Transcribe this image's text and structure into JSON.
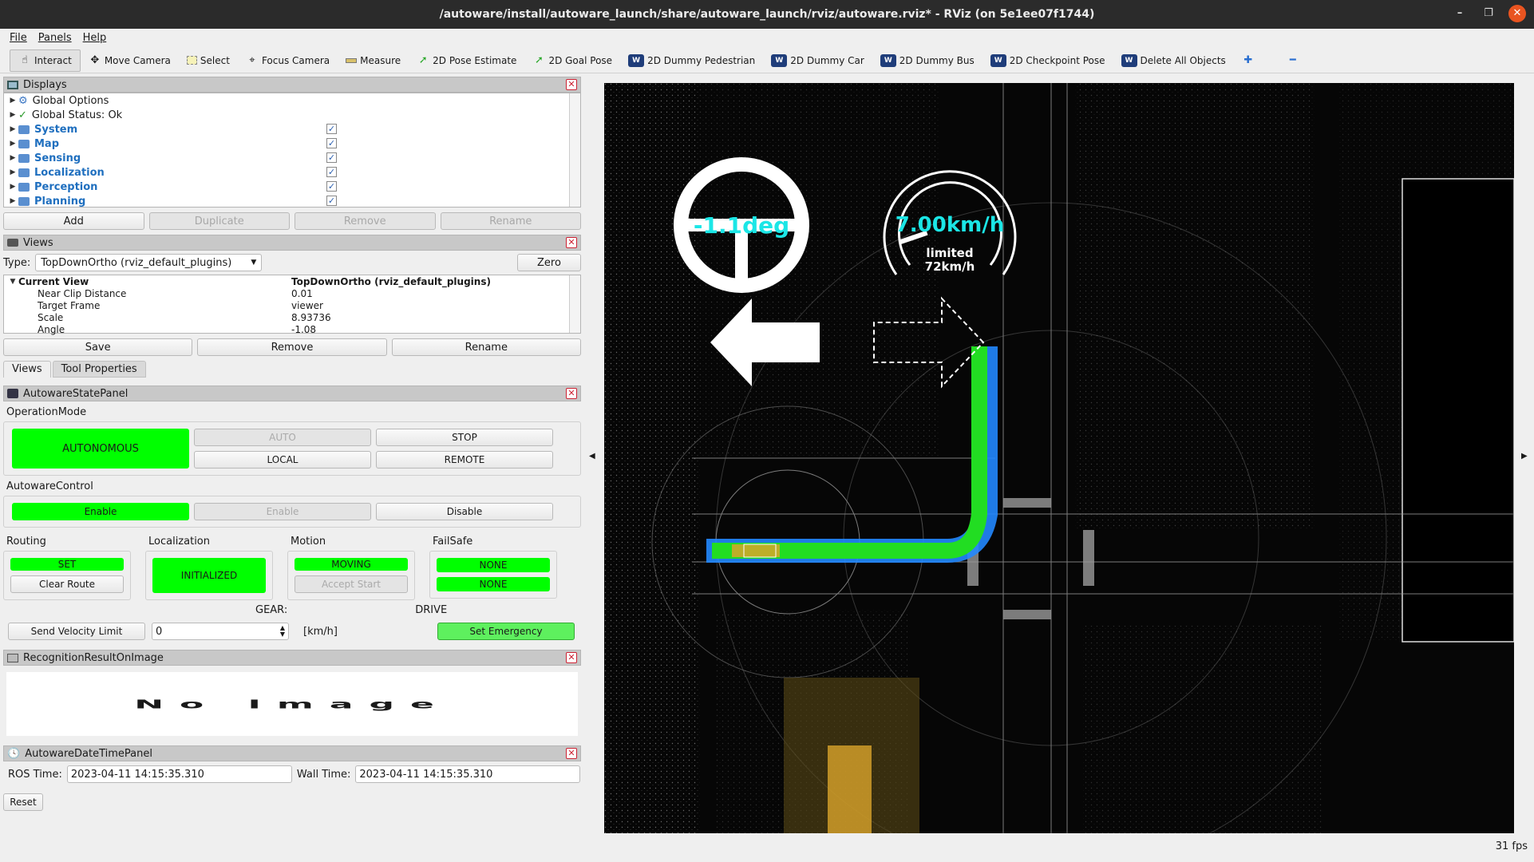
{
  "window": {
    "title": "/autoware/install/autoware_launch/share/autoware_launch/rviz/autoware.rviz* - RViz (on 5e1ee07f1744)"
  },
  "menu": {
    "items": [
      "File",
      "Panels",
      "Help"
    ]
  },
  "toolbar": {
    "interact": "Interact",
    "move_camera": "Move Camera",
    "select": "Select",
    "focus_camera": "Focus Camera",
    "measure": "Measure",
    "pose_estimate": "2D Pose Estimate",
    "goal_pose": "2D Goal Pose",
    "dummy_pedestrian": "2D Dummy Pedestrian",
    "dummy_car": "2D Dummy Car",
    "dummy_bus": "2D Dummy Bus",
    "checkpoint_pose": "2D Checkpoint Pose",
    "delete_all": "Delete All Objects"
  },
  "displays": {
    "title": "Displays",
    "items": [
      {
        "label": "Global Options"
      },
      {
        "label": "Global Status: Ok"
      },
      {
        "label": "System"
      },
      {
        "label": "Map"
      },
      {
        "label": "Sensing"
      },
      {
        "label": "Localization"
      },
      {
        "label": "Perception"
      },
      {
        "label": "Planning"
      }
    ],
    "buttons": {
      "add": "Add",
      "duplicate": "Duplicate",
      "remove": "Remove",
      "rename": "Rename"
    }
  },
  "views": {
    "title": "Views",
    "type_label": "Type:",
    "type_value": "TopDownOrtho (rviz_default_plugins)",
    "zero": "Zero",
    "current_view_label": "Current View",
    "current_view_value": "TopDownOrtho (rviz_default_plugins)",
    "props": [
      {
        "k": "Near Clip Distance",
        "v": "0.01"
      },
      {
        "k": "Target Frame",
        "v": "viewer"
      },
      {
        "k": "Scale",
        "v": "8.93736"
      },
      {
        "k": "Angle",
        "v": "-1.08"
      }
    ],
    "buttons": {
      "save": "Save",
      "remove": "Remove",
      "rename": "Rename"
    },
    "tabs": [
      "Views",
      "Tool Properties"
    ]
  },
  "state_panel": {
    "title": "AutowareStatePanel",
    "operation_mode_label": "OperationMode",
    "autonomous": "AUTONOMOUS",
    "auto": "AUTO",
    "stop": "STOP",
    "local": "LOCAL",
    "remote": "REMOTE",
    "control_label": "AutowareControl",
    "enable_active": "Enable",
    "enable_disabled": "Enable",
    "disable": "Disable",
    "routing_label": "Routing",
    "routing_state": "SET",
    "clear_route": "Clear Route",
    "localization_label": "Localization",
    "localization_state": "INITIALIZED",
    "motion_label": "Motion",
    "motion_state": "MOVING",
    "accept_start": "Accept Start",
    "failsafe_label": "FailSafe",
    "failsafe_1": "NONE",
    "failsafe_2": "NONE",
    "gear_label": "GEAR:",
    "gear_value": "DRIVE",
    "send_velocity": "Send Velocity Limit",
    "velocity_value": "0",
    "velocity_unit": "[km/h]",
    "set_emergency": "Set Emergency"
  },
  "recognition": {
    "title": "RecognitionResultOnImage",
    "no_image": "No Image"
  },
  "datetime": {
    "title": "AutowareDateTimePanel",
    "ros_label": "ROS Time:",
    "ros_value": "2023-04-11 14:15:35.310",
    "wall_label": "Wall Time:",
    "wall_value": "2023-04-11 14:15:35.310"
  },
  "reset": "Reset",
  "viewport": {
    "steering": "-1.1deg",
    "speed": "7.00km/h",
    "limited_label": "limited",
    "limited_value": "72km/h",
    "speed_ratio": 0.097
  },
  "fps": "31 fps"
}
